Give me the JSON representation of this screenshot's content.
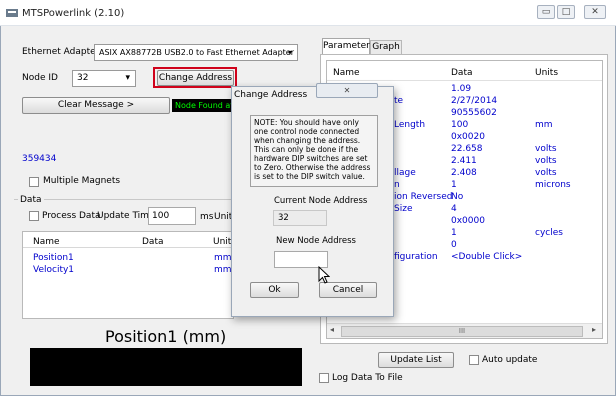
{
  "window": {
    "title": "MTSPowerlink (2.10)",
    "min": "▭",
    "max": "□",
    "close": "✕"
  },
  "left": {
    "eth_label": "Ethernet Adapters:",
    "eth_value": "ASIX AX88772B USB2.0 to Fast Ethernet Adapter",
    "node_label": "Node ID",
    "node_value": "32",
    "change_address": "Change Address",
    "clear_message": "Clear Message >",
    "status": "Node Found at",
    "serial": "359434",
    "multiple_magnets": "Multiple Magnets",
    "data_group": "Data",
    "process_data": "Process Data",
    "update_time_label": "Update Time:",
    "update_time_value": "100",
    "ms": "ms",
    "units_label": "Unit",
    "list_headers": [
      "Name",
      "Data",
      "Units"
    ],
    "list_rows": [
      {
        "name": "Position1",
        "data": "",
        "units": "mm"
      },
      {
        "name": "Velocity1",
        "data": "",
        "units": "mm/"
      }
    ],
    "big_label": "Position1 (mm)"
  },
  "right": {
    "tabs": [
      "Parameters",
      "Graph"
    ],
    "headers": [
      "Name",
      "Data",
      "Units"
    ],
    "rows": [
      {
        "name": "",
        "data": "1.09",
        "units": ""
      },
      {
        "name": "te",
        "data": "2/27/2014",
        "units": ""
      },
      {
        "name": "",
        "data": "90555602",
        "units": ""
      },
      {
        "name": "Length",
        "data": "100",
        "units": "mm"
      },
      {
        "name": "",
        "data": "0x0020",
        "units": ""
      },
      {
        "name": "",
        "data": "22.658",
        "units": "volts"
      },
      {
        "name": "",
        "data": "2.411",
        "units": "volts"
      },
      {
        "name": "llage",
        "data": "2.408",
        "units": "volts"
      },
      {
        "name": "n",
        "data": "1",
        "units": "microns"
      },
      {
        "name": "ion Reversed",
        "data": "No",
        "units": ""
      },
      {
        "name": "Size",
        "data": "4",
        "units": ""
      },
      {
        "name": "",
        "data": "0x0000",
        "units": ""
      },
      {
        "name": "",
        "data": "1",
        "units": "cycles"
      },
      {
        "name": "",
        "data": "0",
        "units": ""
      },
      {
        "name": "figuration",
        "data": "<Double Click>",
        "units": ""
      }
    ],
    "scroll_mid": "III",
    "update_list": "Update List",
    "auto_update": "Auto update",
    "log_data": "Log Data To File"
  },
  "dialog": {
    "title": "Change Address",
    "close": "✕",
    "note": "NOTE: You should have only one control node connected when changing the address. This can only be done if the hardware DIP switches are set to Zero. Otherwise the address is set to the DIP switch value.",
    "current_label": "Current Node Address",
    "current_value": "32",
    "new_label": "New Node Address",
    "new_value": "",
    "ok": "Ok",
    "cancel": "Cancel"
  },
  "colors": {
    "highlight_red": "#d0021b",
    "status_green": "#00ff00",
    "link_blue": "#0000cc"
  }
}
